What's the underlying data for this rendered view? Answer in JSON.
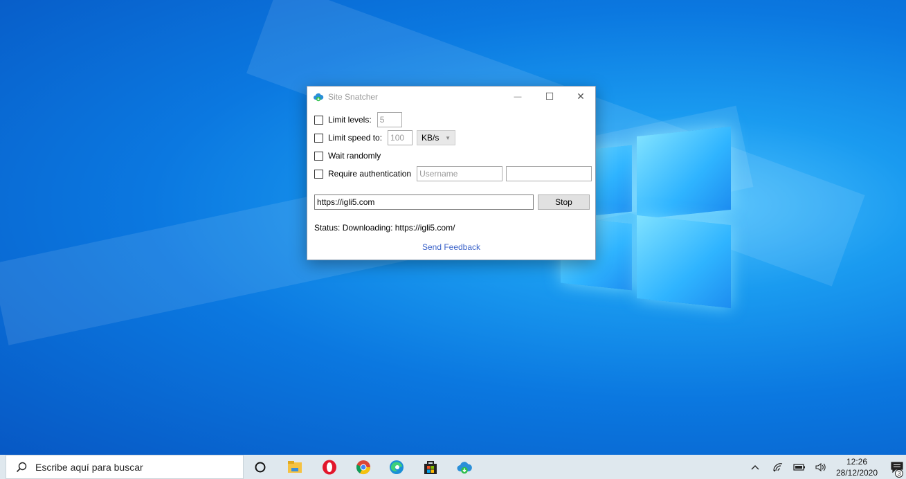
{
  "window": {
    "title": "Site Snatcher",
    "minimize_glyph": "—",
    "maximize_glyph": "☐",
    "close_glyph": "✕"
  },
  "options": {
    "limit_levels": {
      "label": "Limit levels:",
      "checked": false,
      "value": "5"
    },
    "limit_speed": {
      "label": "Limit speed to:",
      "checked": false,
      "value": "100",
      "unit": "KB/s"
    },
    "wait_randomly": {
      "label": "Wait randomly",
      "checked": false
    },
    "require_auth": {
      "label": "Require authentication",
      "checked": false,
      "username_placeholder": "Username",
      "password_value": ""
    }
  },
  "url": {
    "value": "https://igli5.com"
  },
  "stop_label": "Stop",
  "status_text": "Status: Downloading: https://igli5.com/",
  "feedback_label": "Send Feedback",
  "taskbar": {
    "search_placeholder": "Escribe aquí para buscar",
    "apps": [
      "task-view",
      "file-explorer",
      "opera",
      "chrome",
      "edge",
      "store",
      "site-snatcher"
    ],
    "tray": {
      "chevron": "^",
      "time": "12:26",
      "date": "28/12/2020",
      "notification_count": "3"
    }
  },
  "colors": {
    "accent": "#0078d7",
    "link": "#3b63c9",
    "desktop": "#0b78e0"
  }
}
